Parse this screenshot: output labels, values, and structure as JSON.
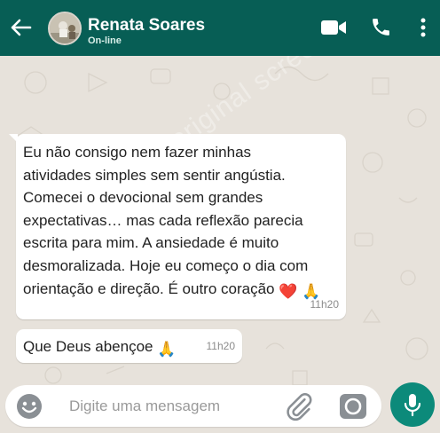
{
  "header": {
    "contact_name": "Renata Soares",
    "status": "On-line",
    "icons": [
      "back-arrow-icon",
      "video-call-icon",
      "phone-icon",
      "more-options-icon"
    ]
  },
  "messages": [
    {
      "text": "Eu não consigo nem fazer minhas\natividades simples sem sentir angústia.\nComecei o devocional sem grandes\nexpectativas… mas cada reflexão parecia\nescrita para mim. A ansiedade é muito\ndesmoralizada. Hoje eu começo o dia com\norientação e direção. É outro coração",
      "emojis": "❤️ 🙏",
      "time": "11h20"
    },
    {
      "text": "Que Deus abençoe",
      "emojis": "🙏",
      "time": "11h20"
    }
  ],
  "watermark": "This is not an original screenshot!!!",
  "composer": {
    "placeholder": "Digite uma mensagem",
    "icons": [
      "emoji-icon",
      "attach-icon",
      "camera-icon",
      "microphone-icon"
    ]
  },
  "colors": {
    "header": "#075e55",
    "wallpaper": "#e7e2db",
    "bubble": "#ffffff",
    "mic_button": "#0c8a7a"
  }
}
